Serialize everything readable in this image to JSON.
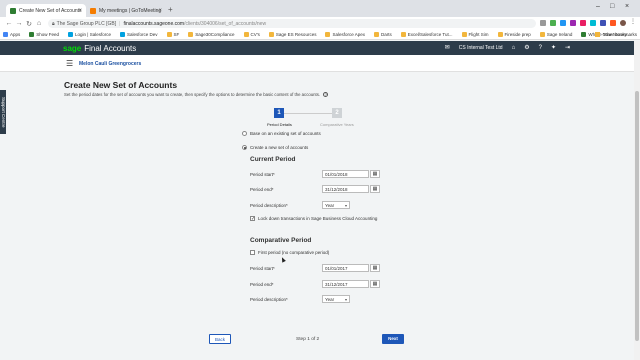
{
  "browser": {
    "tabs": [
      {
        "title": "Create New Set of Accounts",
        "color": "#2e7d32",
        "active": true
      },
      {
        "title": "My meetings | GoToMeeting",
        "color": "#f57c00",
        "active": false
      }
    ],
    "url_site": "The Sage Group PLC [GB]",
    "url_domain": "finalaccounts.sageone.com",
    "url_path": "/clients/304006/set_of_accounts/new",
    "bookmarks": [
      "Apps",
      "Show Feed",
      "Login | Salesforce",
      "Salesforce Dev",
      "SF",
      "Sage30Compliance",
      "CV's",
      "Sage ES Resources",
      "Salesforce Apex",
      "Darts",
      "Excel/Salesforce Tut...",
      "Flight Sim",
      "Fireside prep",
      "Sage Ireland",
      "Where Your Money..."
    ],
    "other_bookmarks": "Other bookmarks"
  },
  "header": {
    "logo": "sage",
    "product": "Final Accounts",
    "company": "CS Internal Test Ltd",
    "business_name": "Melon Cauli Greengrocers",
    "support_tab": "Support Centre"
  },
  "page": {
    "title": "Create New Set of Accounts",
    "description": "Set the period dates for the set of accounts you want to create, then specify the options to determine the basic content of the accounts.",
    "steps": [
      {
        "number": "1",
        "label": "Period Details"
      },
      {
        "number": "2",
        "label": "Comparative Years"
      }
    ],
    "option_existing": "Base on an existing set of accounts",
    "option_new": "Create a new set of accounts",
    "current_period": {
      "title": "Current Period",
      "start_label": "Period start*",
      "start_value": "01/01/2018",
      "end_label": "Period end*",
      "end_value": "31/12/2018",
      "desc_label": "Period description*",
      "desc_value": "Year",
      "lock_label": "Lock down transactions in Sage Business Cloud Accounting"
    },
    "comparative_period": {
      "title": "Comparative Period",
      "first_period_label": "First period (no comparative period)",
      "start_label": "Period start*",
      "start_value": "01/01/2017",
      "end_label": "Period end*",
      "end_value": "31/12/2017",
      "desc_label": "Period description*",
      "desc_value": "Year"
    },
    "footer": {
      "back": "Back",
      "step_text": "Step 1 of 2",
      "next": "Next"
    }
  },
  "colors": {
    "sage_green": "#00dc06",
    "header_bg": "#2d3c4a",
    "primary_blue": "#1e57b8"
  }
}
